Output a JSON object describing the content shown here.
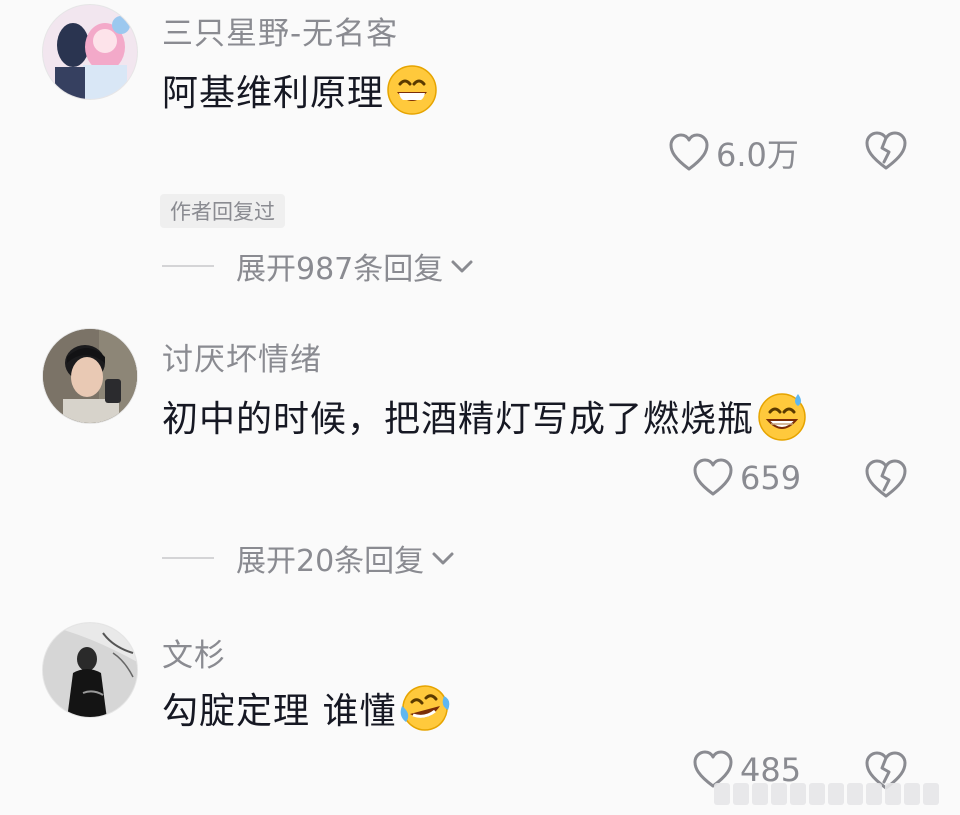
{
  "comments": [
    {
      "username": "三只星野-无名客",
      "text": "阿基维利原理",
      "likes": "6.0万",
      "author_badge": "作者回复过",
      "expand_label": "展开987条回复",
      "emoji": "grinning-face"
    },
    {
      "username": "讨厌坏情绪",
      "text": "初中的时候，把酒精灯写成了燃烧瓶",
      "likes": "659",
      "expand_label": "展开20条回复",
      "emoji": "grinning-face-with-sweat"
    },
    {
      "username": "文杉",
      "text": "勾腚定理 谁懂",
      "likes": "485",
      "emoji": "face-with-tears-of-joy"
    }
  ],
  "icons": {
    "like": "heart-outline-icon",
    "dislike": "broken-heart-icon",
    "expand": "chevron-down-icon"
  },
  "colors": {
    "background": "#fafafa",
    "primary_text": "#161823",
    "secondary_text": "#8a8b91",
    "badge_bg": "#efefef"
  }
}
